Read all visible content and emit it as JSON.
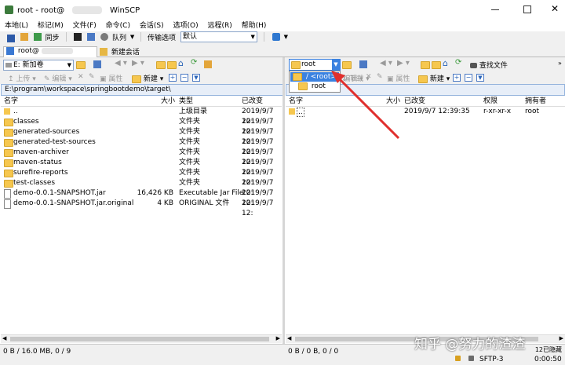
{
  "window": {
    "title": "root - root@",
    "app": "WinSCP"
  },
  "menu": [
    "本地(L)",
    "标记(M)",
    "文件(F)",
    "命令(C)",
    "会话(S)",
    "选项(O)",
    "远程(R)",
    "帮助(H)"
  ],
  "toolbar": {
    "sync": "同步",
    "queue": "队列",
    "transfer_label": "传输选项",
    "transfer_value": "默认"
  },
  "tabs": {
    "session": "root@",
    "new": "新建会话"
  },
  "local": {
    "drive": "E: 新加卷",
    "path": "E:\\program\\workspace\\springbootdemo\\target\\",
    "upload": "上传",
    "edit": "编辑",
    "props": "属性",
    "newbtn": "新建",
    "headers": [
      "名字",
      "大小",
      "类型",
      "已改变"
    ],
    "rows": [
      {
        "name": "..",
        "size": "",
        "type": "上级目录",
        "date": "2019/9/7  12:"
      },
      {
        "name": "classes",
        "size": "",
        "type": "文件夹",
        "date": "2019/9/7  12:"
      },
      {
        "name": "generated-sources",
        "size": "",
        "type": "文件夹",
        "date": "2019/9/7  12:"
      },
      {
        "name": "generated-test-sources",
        "size": "",
        "type": "文件夹",
        "date": "2019/9/7  12:"
      },
      {
        "name": "maven-archiver",
        "size": "",
        "type": "文件夹",
        "date": "2019/9/7  12:"
      },
      {
        "name": "maven-status",
        "size": "",
        "type": "文件夹",
        "date": "2019/9/7  12:"
      },
      {
        "name": "surefire-reports",
        "size": "",
        "type": "文件夹",
        "date": "2019/9/7  12:"
      },
      {
        "name": "test-classes",
        "size": "",
        "type": "文件夹",
        "date": "2019/9/7  12:"
      },
      {
        "name": "demo-0.0.1-SNAPSHOT.jar",
        "size": "16,426 KB",
        "type": "Executable Jar File",
        "date": "2019/9/7  12:"
      },
      {
        "name": "demo-0.0.1-SNAPSHOT.jar.original",
        "size": "4 KB",
        "type": "ORIGINAL 文件",
        "date": "2019/9/7  12:"
      }
    ],
    "status": "0 B / 16.0 MB,  0 / 9"
  },
  "remote": {
    "dir_value": "root",
    "dropdown": [
      "/ <root>",
      "root"
    ],
    "find": "查找文件",
    "download": "下载",
    "edit": "编辑",
    "props": "属性",
    "newbtn": "新建",
    "path": "/root",
    "headers": [
      "名字",
      "大小",
      "已改变",
      "权限",
      "拥有者"
    ],
    "rows": [
      {
        "name": "..",
        "size": "",
        "date": "2019/9/7  12:39:35",
        "perm": "r-xr-xr-x",
        "owner": "root"
      }
    ],
    "status": "0 B / 0 B,  0 / 0"
  },
  "statusbar": {
    "protocol": "SFTP-3",
    "time": "0:00:50",
    "hidden": "12已隐藏"
  },
  "watermark": "知乎 @努力的渣渣",
  "colors": {
    "highlight": "#3b82e0",
    "arrow": "#e0302e"
  }
}
